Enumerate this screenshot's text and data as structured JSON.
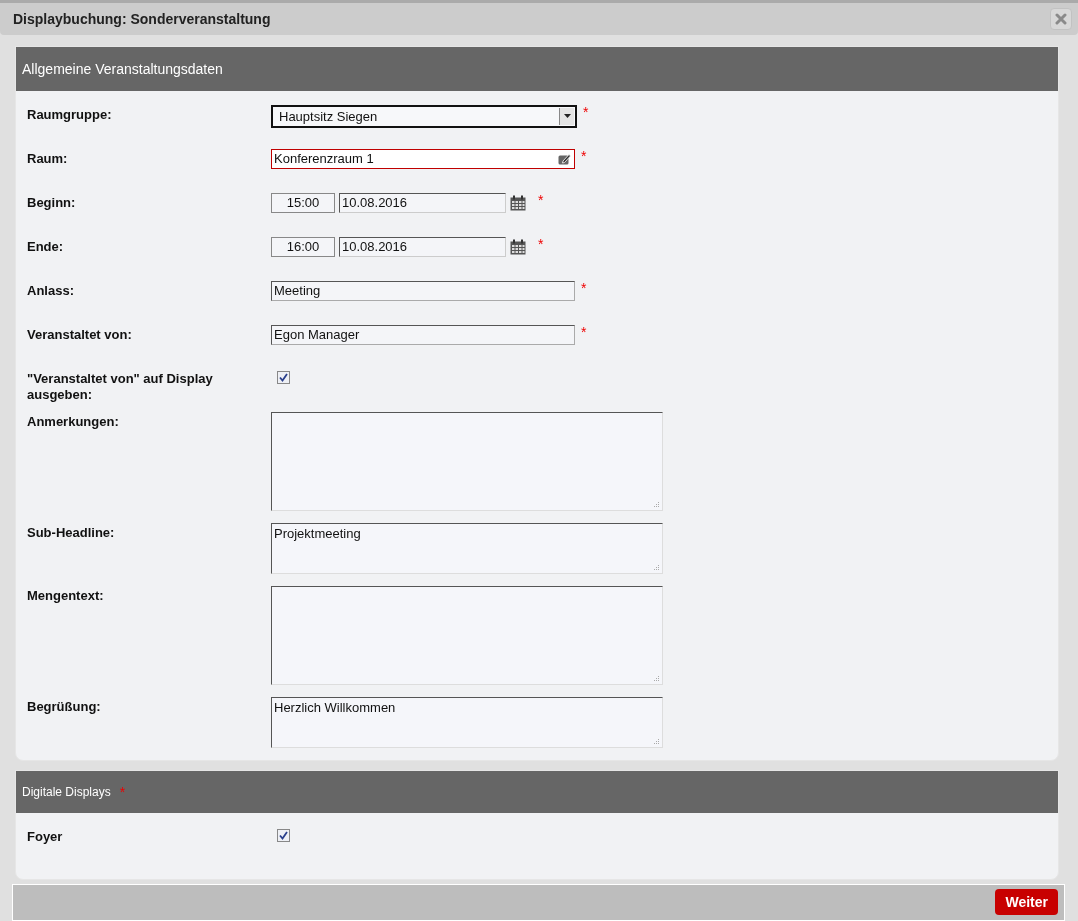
{
  "dialog": {
    "title": "Displaybuchung: Sonderveranstaltung"
  },
  "sections": [
    {
      "title": "Allgemeine Veranstaltungsdaten",
      "kind": "main",
      "fields": [
        {
          "kind": "select",
          "label": "Raumgruppe:",
          "value": "Hauptsitz Siegen",
          "required_mark": "*"
        },
        {
          "kind": "lookup",
          "label": "Raum:",
          "value": "Konferenzraum 1",
          "invalid": true,
          "required_mark": "*"
        },
        {
          "kind": "datetime",
          "label": "Beginn:",
          "time": "15:00",
          "date": "10.08.2016",
          "required_mark": "*"
        },
        {
          "kind": "datetime",
          "label": "Ende:",
          "time": "16:00",
          "date": "10.08.2016",
          "required_mark": "*"
        },
        {
          "kind": "text",
          "label": "Anlass:",
          "value": "Meeting",
          "invalid": false,
          "required_mark": "*"
        },
        {
          "kind": "text",
          "label": "Veranstaltet von:",
          "value": "Egon Manager",
          "invalid": false,
          "required_mark": "*"
        },
        {
          "kind": "checkbox",
          "label": "\"Veranstaltet von\" auf Display ausgeben:",
          "checked": true
        },
        {
          "kind": "textarea",
          "label": "Anmerkungen:"
        },
        {
          "kind": "short-textarea",
          "label": "Sub-Headline:",
          "value": "Projektmeeting"
        },
        {
          "kind": "textarea",
          "label": "Mengentext:"
        },
        {
          "kind": "short-textarea",
          "label": "Begrüßung:",
          "value": "Herzlich Willkommen"
        }
      ]
    },
    {
      "title": "Digitale Displays",
      "required_mark": "*",
      "kind": "small",
      "fields": [
        {
          "kind": "checkbox",
          "label": "Foyer",
          "checked": true
        }
      ]
    }
  ],
  "footer": {
    "button": "Weiter"
  }
}
